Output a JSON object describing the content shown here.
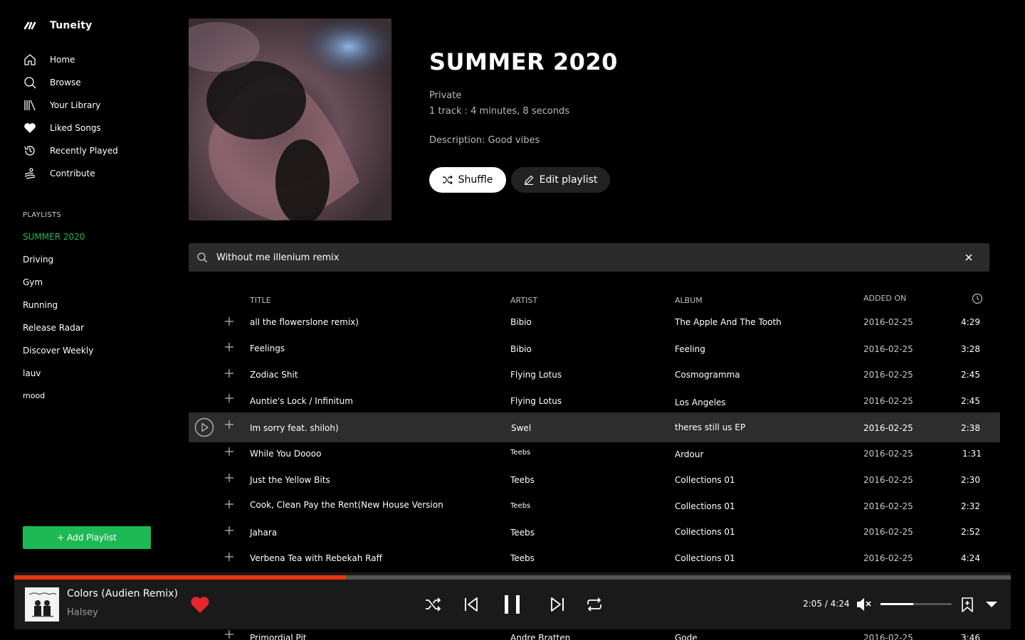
{
  "app": {
    "name": "Tuneity"
  },
  "nav": [
    {
      "label": "Home",
      "icon": "home-icon"
    },
    {
      "label": "Browse",
      "icon": "search-icon"
    },
    {
      "label": "Your Library",
      "icon": "library-icon"
    },
    {
      "label": "Liked Songs",
      "icon": "heart-icon"
    },
    {
      "label": "Recently Played",
      "icon": "history-icon"
    },
    {
      "label": "Contribute",
      "icon": "contribute-icon"
    }
  ],
  "playlists": {
    "header": "PLAYLISTS",
    "items": [
      "SUMMER 2020",
      "Driving",
      "Gym",
      "Running",
      "Release Radar",
      "Discover Weekly",
      "lauv",
      "mood"
    ],
    "active": "SUMMER 2020",
    "add_label": "+ Add Playlist"
  },
  "playlist": {
    "title": "SUMMER 2020",
    "visibility": "Private",
    "summary": "1 track : 4 minutes, 8 seconds",
    "description": "Description: Good vibes",
    "shuffle_label": "Shuffle",
    "edit_label": "Edit playlist"
  },
  "search": {
    "value": "Without me illenium remix"
  },
  "table": {
    "headers": {
      "title": "TITLE",
      "artist": "ARTIST",
      "album": "ALBUM",
      "added": "ADDED ON"
    },
    "rows": [
      {
        "title": "all the flowerslone remix)",
        "artist": "Bibio",
        "album": "The Apple And The Tooth",
        "added": "2016-02-25",
        "duration": "4:29"
      },
      {
        "title": "Feelings",
        "artist": "Bibio",
        "album": "Feeling",
        "added": "2016-02-25",
        "duration": "3:28"
      },
      {
        "title": "Zodiac Shit",
        "artist": "Flying Lotus",
        "album": "Cosmogramma",
        "added": "2016-02-25",
        "duration": "2:45"
      },
      {
        "title": "Auntie's Lock / Infinitum",
        "artist": "Flying Lotus",
        "album": "Los Angeles",
        "added": "2016-02-25",
        "duration": "2:45"
      },
      {
        "title": "Im sorry feat. shiloh)",
        "artist": "Swel",
        "album": "theres still us EP",
        "added": "2016-02-25",
        "duration": "2:38",
        "selected": true
      },
      {
        "title": "While You Doooo",
        "artist": "Teebs",
        "album": "Ardour",
        "added": "2016-02-25",
        "duration": "1:31"
      },
      {
        "title": "Just the Yellow Bits",
        "artist": "Teebs",
        "album": "Collections 01",
        "added": "2016-02-25",
        "duration": "2:30"
      },
      {
        "title": "Cook, Clean Pay the Rent(New House Version",
        "artist": "Teebs",
        "album": "Collections 01",
        "added": "2016-02-25",
        "duration": "2:32"
      },
      {
        "title": "Jahara",
        "artist": "Teebs",
        "album": "Collections 01",
        "added": "2016-02-25",
        "duration": "2:52"
      },
      {
        "title": "Verbena Tea with Rebekah Raff",
        "artist": "Teebs",
        "album": "Collections 01",
        "added": "2016-02-25",
        "duration": "4:24"
      },
      {
        "title": "Primordial Pit",
        "artist": "Andre Bratten",
        "album": "Gode",
        "added": "2016-02-25",
        "duration": "3:46"
      }
    ]
  },
  "player": {
    "title": "Colors (Audien Remix)",
    "artist": "Halsey",
    "time": "2:05 / 4:24",
    "progress": 0.333,
    "volume": 0.46,
    "liked": true,
    "accent": "#e8340f",
    "heart_color": "#e8242c",
    "green": "#1db954"
  }
}
